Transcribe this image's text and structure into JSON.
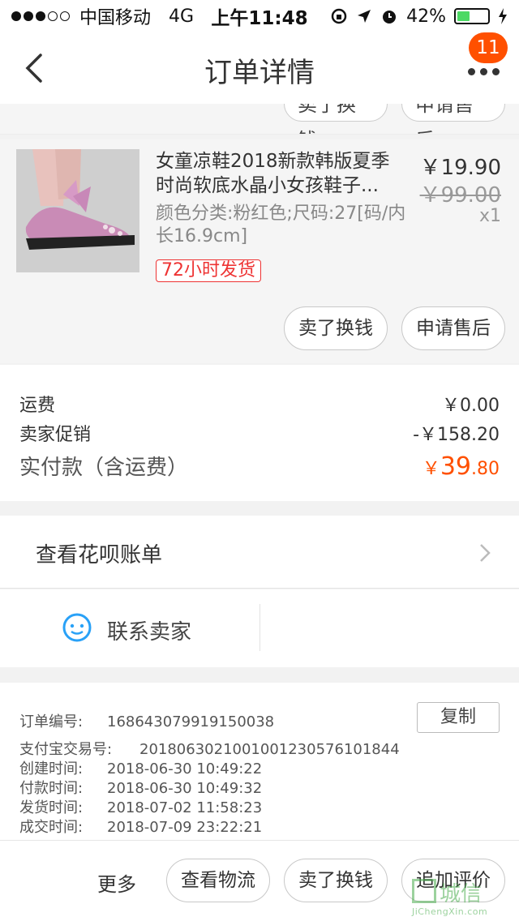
{
  "status_bar": {
    "carrier": "中国移动",
    "network": "4G",
    "time": "上午11:48",
    "battery_text": "42%",
    "battery_level": 0.42
  },
  "nav": {
    "title": "订单详情",
    "badge": "11",
    "back_icon": "chevron-left-icon",
    "more_icon": "more-dots-icon"
  },
  "top_partial_buttons": {
    "sell": "卖了换钱",
    "after_sale": "申请售后"
  },
  "item": {
    "title": "女童凉鞋2018新款韩版夏季时尚软底水晶小女孩鞋子...",
    "sku": "颜色分类:粉红色;尺码:27[码/内长16.9cm]",
    "tag": "72小时发货",
    "price": "￥19.90",
    "original_price": "￥99.00",
    "quantity": "x1",
    "btn_sell": "卖了换钱",
    "btn_after_sale": "申请售后"
  },
  "summary": {
    "shipping_label": "运费",
    "shipping_value": "￥0.00",
    "promo_label": "卖家促销",
    "promo_value": "-￥158.20",
    "paid_label": "实付款（含运费）",
    "paid_currency": "￥",
    "paid_int": "39",
    "paid_dec": ".80"
  },
  "huabei": {
    "label": "查看花呗账单"
  },
  "contact": {
    "label": "联系卖家"
  },
  "order_info": {
    "order_no_label": "订单编号:",
    "order_no": "168643079919150038",
    "copy": "复制",
    "alipay_label": "支付宝交易号:",
    "alipay_no": "2018063021001001230576101844",
    "created_label": "创建时间:",
    "created": "2018-06-30 10:49:22",
    "paid_label": "付款时间:",
    "paid": "2018-06-30 10:49:32",
    "shipped_label": "发货时间:",
    "shipped": "2018-07-02 11:58:23",
    "done_label": "成交时间:",
    "done": "2018-07-09 23:22:21"
  },
  "bottom_bar": {
    "more": "更多",
    "logistics": "查看物流",
    "sell": "卖了换钱",
    "review": "追加评价"
  },
  "watermark": {
    "text": "城信",
    "small": "JiChengXin.com"
  },
  "colors": {
    "accent": "#ff5000",
    "tag_red": "#ee3333"
  }
}
